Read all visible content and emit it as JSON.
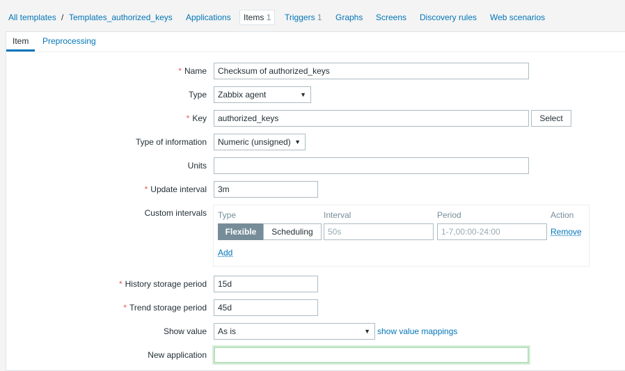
{
  "breadcrumb": {
    "all_templates": "All templates",
    "separator": "/",
    "template_name": "Templates_authorized_keys"
  },
  "nav": {
    "applications": "Applications",
    "items": "Items",
    "items_count": "1",
    "triggers": "Triggers",
    "triggers_count": "1",
    "graphs": "Graphs",
    "screens": "Screens",
    "discovery_rules": "Discovery rules",
    "web_scenarios": "Web scenarios"
  },
  "tabs": {
    "item": "Item",
    "preprocessing": "Preprocessing"
  },
  "form": {
    "required_mark": "*",
    "name_label": "Name",
    "name_value": "Checksum of authorized_keys",
    "type_label": "Type",
    "type_value": "Zabbix agent",
    "key_label": "Key",
    "key_value": "authorized_keys",
    "select_button": "Select",
    "type_info_label": "Type of information",
    "type_info_value": "Numeric (unsigned)",
    "units_label": "Units",
    "units_value": "",
    "update_interval_label": "Update interval",
    "update_interval_value": "3m",
    "custom_intervals_label": "Custom intervals",
    "ci": {
      "col_type": "Type",
      "col_interval": "Interval",
      "col_period": "Period",
      "col_action": "Action",
      "flexible": "Flexible",
      "scheduling": "Scheduling",
      "interval_placeholder": "50s",
      "period_placeholder": "1-7,00:00-24:00",
      "remove": "Remove",
      "add": "Add"
    },
    "history_label": "History storage period",
    "history_value": "15d",
    "trend_label": "Trend storage period",
    "trend_value": "45d",
    "show_value_label": "Show value",
    "show_value_value": "As is",
    "show_value_mappings": "show value mappings",
    "new_app_label": "New application",
    "new_app_value": ""
  },
  "colors": {
    "link": "#0275b8",
    "required": "#e45959",
    "active_segment": "#768d99",
    "focus": "#b7e0bd"
  }
}
